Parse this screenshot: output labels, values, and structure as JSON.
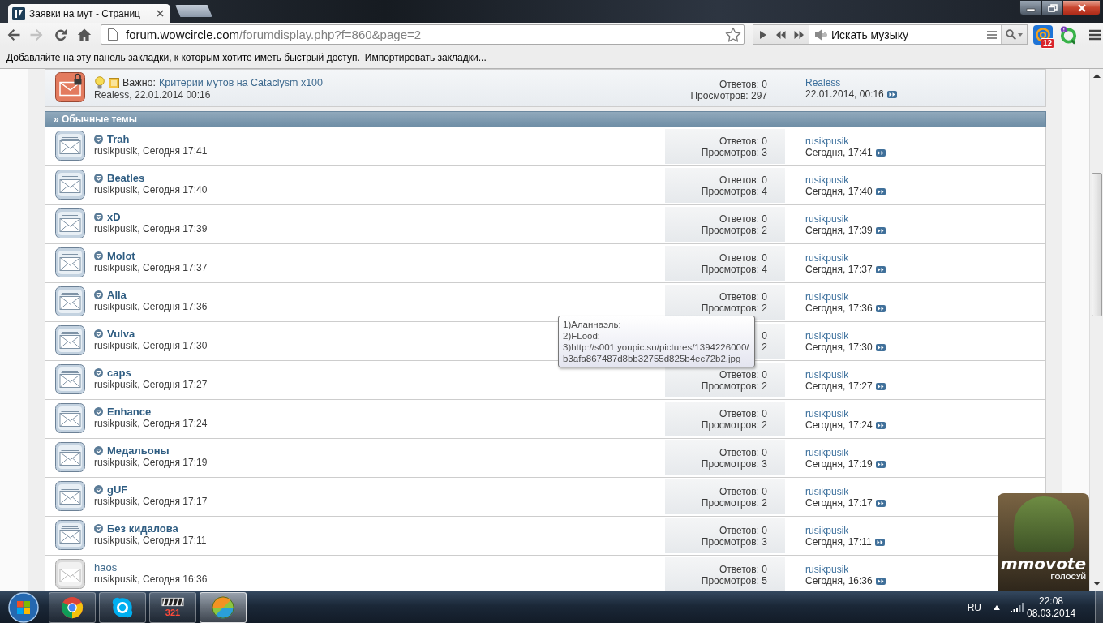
{
  "browser": {
    "tab": {
      "title": "Заявки на мут - Страниц"
    },
    "nav_buttons": [
      {
        "kind": "back",
        "disabled": false
      },
      {
        "kind": "forward",
        "disabled": true
      },
      {
        "kind": "reload",
        "disabled": false
      },
      {
        "kind": "home",
        "disabled": false
      }
    ],
    "address": {
      "host": "forum.wowcircle.com",
      "path": "/forumdisplay.php?f=860&page=2"
    },
    "music_player": {
      "search": {
        "placeholder": "Искать музыку"
      }
    },
    "extensions": [
      {
        "kind": "mail",
        "badge": "12"
      },
      {
        "kind": "q"
      }
    ],
    "bookmarks_bar": {
      "message": "Добавляйте на эту панель закладки, к которым хотите иметь быстрый доступ.",
      "link": "Импортировать закладки..."
    }
  },
  "forum": {
    "sticky": {
      "prefix": "Важно:",
      "title": "Критерии мутов на Cataclysm x100",
      "byline": "Realess, 22.01.2014 00:16",
      "replies": "Ответов: 0",
      "views": "Просмотров: 297",
      "last_poster": "Realess",
      "last_date": "22.01.2014, 00:16"
    },
    "section_title": "» Обычные темы",
    "threads": [
      {
        "title": "Trah",
        "byline": "rusikpusik, Сегодня 17:41",
        "replies": "Ответов: 0",
        "views": "Просмотров: 3",
        "last_poster": "rusikpusik",
        "last_date": "Сегодня, 17:41",
        "unread": true
      },
      {
        "title": "Beatles",
        "byline": "rusikpusik, Сегодня 17:40",
        "replies": "Ответов: 0",
        "views": "Просмотров: 4",
        "last_poster": "rusikpusik",
        "last_date": "Сегодня, 17:40",
        "unread": true
      },
      {
        "title": "xD",
        "byline": "rusikpusik, Сегодня 17:39",
        "replies": "Ответов: 0",
        "views": "Просмотров: 2",
        "last_poster": "rusikpusik",
        "last_date": "Сегодня, 17:39",
        "unread": true
      },
      {
        "title": "Molot",
        "byline": "rusikpusik, Сегодня 17:37",
        "replies": "Ответов: 0",
        "views": "Просмотров: 4",
        "last_poster": "rusikpusik",
        "last_date": "Сегодня, 17:37",
        "unread": true
      },
      {
        "title": "Alla",
        "byline": "rusikpusik, Сегодня 17:36",
        "replies": "Ответов: 0",
        "views": "Просмотров: 2",
        "last_poster": "rusikpusik",
        "last_date": "Сегодня, 17:36",
        "unread": true
      },
      {
        "title": "Vulva",
        "byline": "rusikpusik, Сегодня 17:30",
        "replies": "0",
        "views": "2",
        "last_poster": "rusikpusik",
        "last_date": "Сегодня, 17:30",
        "unread": true
      },
      {
        "title": "caps",
        "byline": "rusikpusik, Сегодня 17:27",
        "replies": "Ответов: 0",
        "views": "Просмотров: 2",
        "last_poster": "rusikpusik",
        "last_date": "Сегодня, 17:27",
        "unread": true
      },
      {
        "title": "Enhance",
        "byline": "rusikpusik, Сегодня 17:24",
        "replies": "Ответов: 0",
        "views": "Просмотров: 2",
        "last_poster": "rusikpusik",
        "last_date": "Сегодня, 17:24",
        "unread": true
      },
      {
        "title": "Медальоны",
        "byline": "rusikpusik, Сегодня 17:19",
        "replies": "Ответов: 0",
        "views": "Просмотров: 3",
        "last_poster": "rusikpusik",
        "last_date": "Сегодня, 17:19",
        "unread": true
      },
      {
        "title": "gUF",
        "byline": "rusikpusik, Сегодня 17:17",
        "replies": "Ответов: 0",
        "views": "Просмотров: 2",
        "last_poster": "rusikpusik",
        "last_date": "Сегодня, 17:17",
        "unread": true
      },
      {
        "title": "Без кидалова",
        "byline": "rusikpusik, Сегодня 17:11",
        "replies": "Ответов: 0",
        "views": "Просмотров: 3",
        "last_poster": "rusikpusik",
        "last_date": "Сегодня, 17:11",
        "unread": true
      },
      {
        "title": "haos",
        "byline": "rusikpusik, Сегодня 16:36",
        "replies": "Ответов: 0",
        "views": "Просмотров: 5",
        "last_poster": "rusikpusik",
        "last_date": "Сегодня, 16:36",
        "unread": false
      }
    ]
  },
  "tooltip": {
    "lines": [
      "1)Аланнаэль;",
      "2)FLood;",
      "3)http://s001.youpic.su/pictures/1394226000/",
      "b3afa867487d8bb32755d825b4ec72b2.jpg"
    ]
  },
  "vote_banner": {
    "logo": "mmovote",
    "caption": "ГОЛОСУЙ"
  },
  "taskbar": {
    "apps": [
      {
        "kind": "chrome",
        "selected": false
      },
      {
        "kind": "skype",
        "selected": false
      },
      {
        "kind": "player",
        "label": "321",
        "selected": false
      },
      {
        "kind": "ball",
        "selected": true
      }
    ],
    "language": "RU",
    "time": "22:08",
    "date": "08.03.2014"
  }
}
